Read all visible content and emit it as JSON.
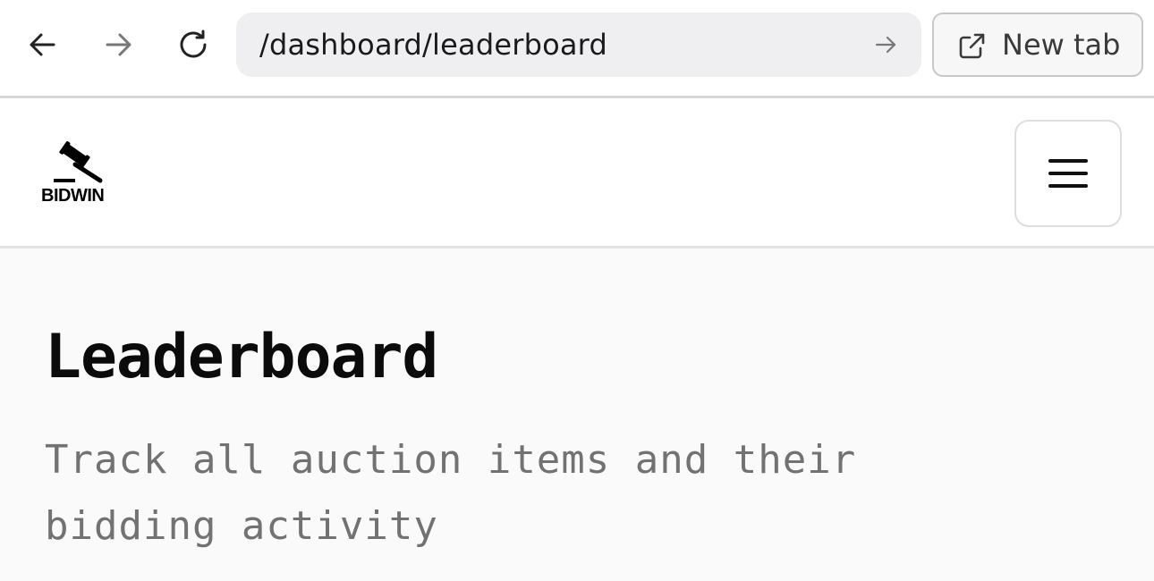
{
  "browser": {
    "url": "/dashboard/leaderboard",
    "new_tab_label": "New tab",
    "icons": {
      "back": "arrow-left-icon",
      "forward": "arrow-right-icon",
      "reload": "reload-icon",
      "go": "arrow-right-icon",
      "new_tab": "external-link-icon"
    }
  },
  "header": {
    "logo_text": "BIDWIN",
    "logo_icon": "gavel-icon",
    "menu_icon": "hamburger-menu-icon"
  },
  "main": {
    "title": "Leaderboard",
    "subtitle": "Track all auction items and their bidding activity"
  }
}
